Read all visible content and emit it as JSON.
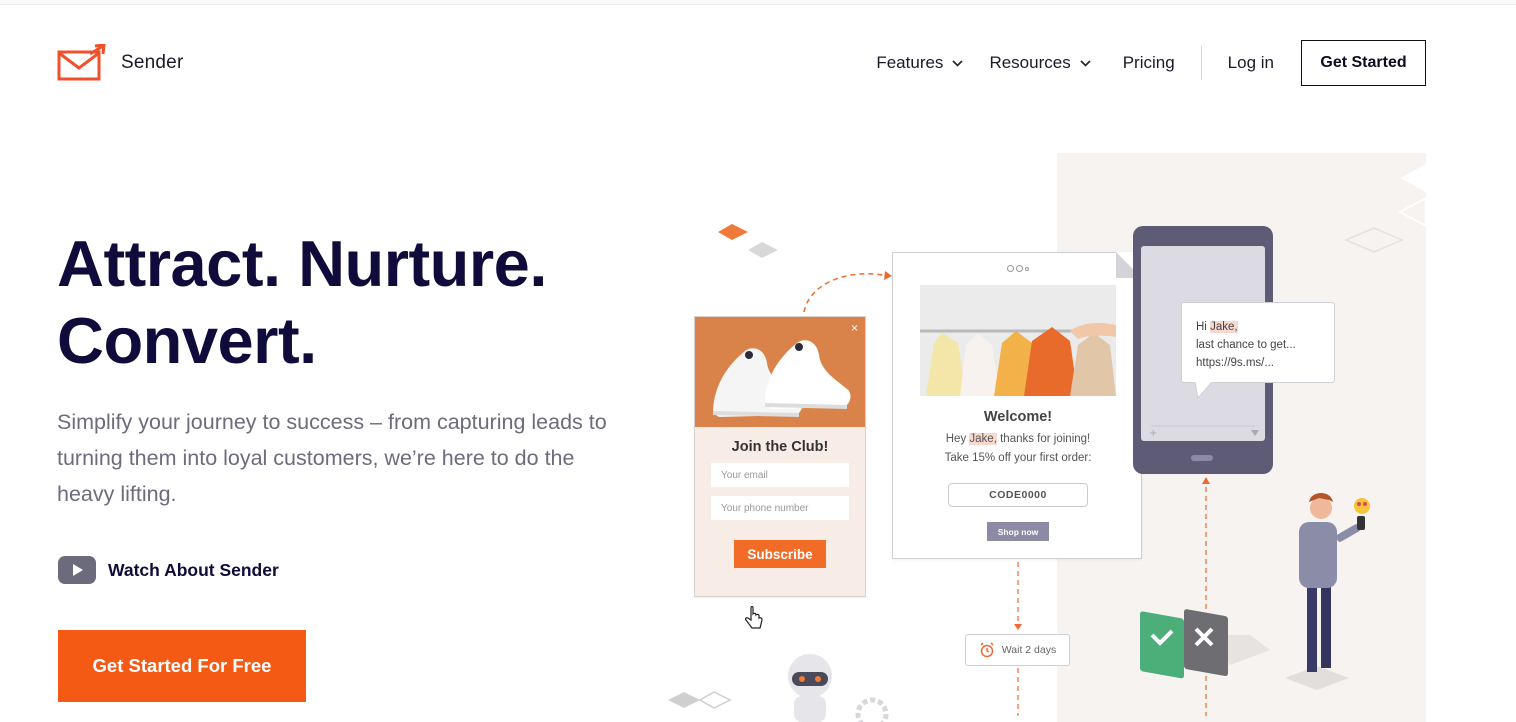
{
  "header": {
    "brand": "Sender",
    "nav": {
      "features": "Features",
      "resources": "Resources",
      "pricing": "Pricing",
      "login": "Log in",
      "get_started": "Get Started"
    }
  },
  "hero": {
    "title_line1": "Attract. Nurture.",
    "title_line2": "Convert.",
    "subtitle": "Simplify your journey to success – from capturing leads to turning them into loyal customers, we’re here to do the heavy lifting.",
    "watch_label": "Watch About Sender",
    "cta_label": "Get Started For Free"
  },
  "illustration": {
    "popup": {
      "title": "Join the Club!",
      "email_placeholder": "Your email",
      "phone_placeholder": "Your phone number",
      "button": "Subscribe",
      "close": "×"
    },
    "email": {
      "welcome": "Welcome!",
      "line1_pre": "Hey ",
      "name": "Jake,",
      "line1_post": " thanks for joining!",
      "line2": "Take 15% off your first order:",
      "code": "CODE0000",
      "button": "Shop now"
    },
    "sms": {
      "greeting": "Hi ",
      "name": "Jake,",
      "line2": "last chance to get...",
      "line3": "https://9s.ms/..."
    },
    "wait": "Wait 2 days"
  },
  "colors": {
    "accent": "#f55a14",
    "title": "#0f0b3a",
    "muted_text": "#6c6c7c"
  }
}
